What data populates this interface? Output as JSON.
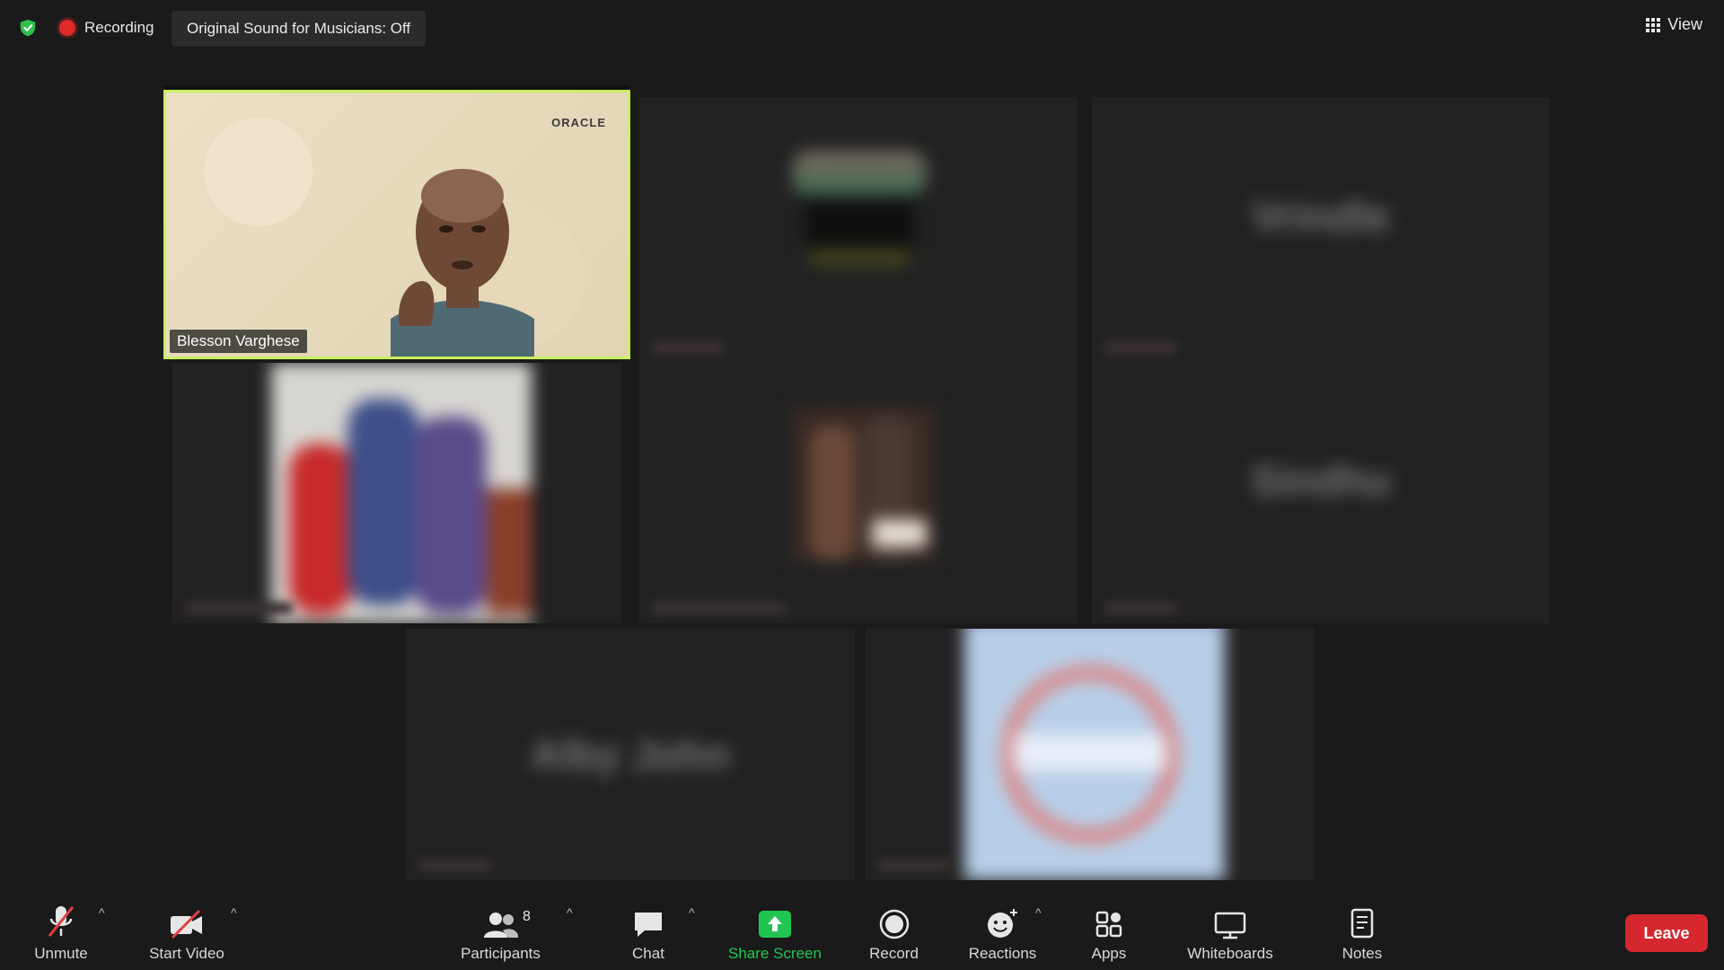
{
  "topbar": {
    "recording_label": "Recording",
    "sound_pill": "Original Sound for Musicians: Off",
    "view_label": "View"
  },
  "speaker": {
    "name": "Blesson Varghese",
    "logo_text": "ORACLE"
  },
  "toolbar": {
    "unmute": "Unmute",
    "start_video": "Start Video",
    "participants": "Participants",
    "participants_count": "8",
    "chat": "Chat",
    "share_screen": "Share Screen",
    "record": "Record",
    "reactions": "Reactions",
    "apps": "Apps",
    "whiteboards": "Whiteboards",
    "notes": "Notes",
    "leave": "Leave"
  },
  "colors": {
    "speaker_border": "#c9ef5f",
    "share_green": "#23c552",
    "leave_red": "#d4272e",
    "recording_red": "#e02a2a",
    "muted_red": "#e04040"
  }
}
